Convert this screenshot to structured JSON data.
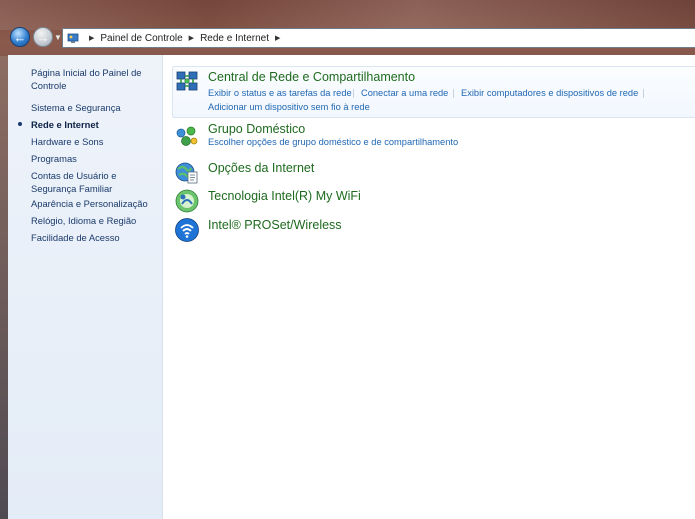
{
  "breadcrumb": {
    "root_label": "Painel de Controle",
    "current_label": "Rede e Internet"
  },
  "sidebar": {
    "items": [
      {
        "label": "Página Inicial do Painel de Controle",
        "active": false
      },
      {
        "label": "Sistema e Segurança",
        "active": false
      },
      {
        "label": "Rede e Internet",
        "active": true
      },
      {
        "label": "Hardware e Sons",
        "active": false
      },
      {
        "label": "Programas",
        "active": false
      },
      {
        "label": "Contas de Usuário e Segurança Familiar",
        "active": false
      },
      {
        "label": "Aparência e Personalização",
        "active": false
      },
      {
        "label": "Relógio, Idioma e Região",
        "active": false
      },
      {
        "label": "Facilidade de Acesso",
        "active": false
      }
    ]
  },
  "categories": [
    {
      "title": "Central de Rede e Compartilhamento",
      "icon": "network-sharing-icon",
      "links": [
        "Exibir o status e as tarefas da rede",
        "Conectar a uma rede",
        "Exibir computadores e dispositivos de rede",
        "Adicionar um dispositivo sem fio à rede"
      ]
    },
    {
      "title": "Grupo Doméstico",
      "icon": "homegroup-icon",
      "links": [
        "Escolher opções de grupo doméstico e de compartilhamento"
      ]
    },
    {
      "title": "Opções da Internet",
      "icon": "internet-options-icon",
      "links": []
    },
    {
      "title": "Tecnologia Intel(R) My WiFi",
      "icon": "intel-my-wifi-icon",
      "links": []
    },
    {
      "title": "Intel® PROSet/Wireless",
      "icon": "intel-proset-wireless-icon",
      "links": []
    }
  ],
  "colors": {
    "title_green": "#1e6a1e",
    "link_blue": "#2068b4",
    "sidebar_bg": "#e4ecf7"
  }
}
